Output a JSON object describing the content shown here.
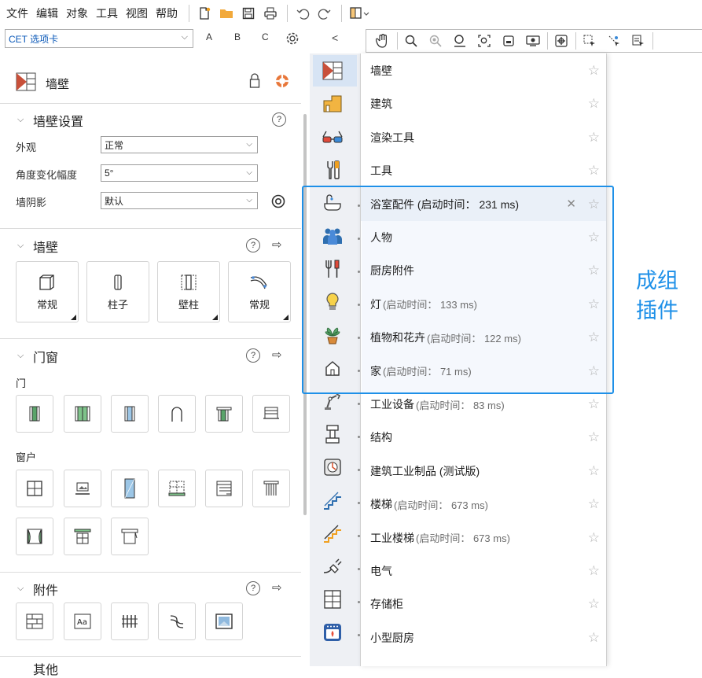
{
  "menubar": {
    "items": [
      "文件",
      "编辑",
      "对象",
      "工具",
      "视图",
      "帮助"
    ]
  },
  "tab_select": {
    "value": "CET 选项卡"
  },
  "abc": [
    "A",
    "B",
    "C"
  ],
  "collapse_arrow": "<",
  "panel": {
    "title": "墙壁",
    "settings": {
      "title": "墙壁设置",
      "fields": [
        {
          "label": "外观",
          "value": "正常"
        },
        {
          "label": "角度变化幅度",
          "value": "5°"
        },
        {
          "label": "墙阴影",
          "value": "默认"
        }
      ]
    },
    "walls": {
      "title": "墙壁",
      "tiles": [
        "常规",
        "柱子",
        "壁柱",
        "常规"
      ]
    },
    "doors_windows": {
      "title": "门窗",
      "doors_label": "门",
      "windows_label": "窗户"
    },
    "accessories": {
      "title": "附件"
    },
    "next_section": "其他"
  },
  "dropdown": {
    "items": [
      {
        "name": "墙壁",
        "startup": ""
      },
      {
        "name": "建筑",
        "startup": ""
      },
      {
        "name": "渲染工具",
        "startup": ""
      },
      {
        "name": "工具",
        "startup": ""
      },
      {
        "name": "浴室配件 (启动时间： 231 ms)",
        "startup": ""
      },
      {
        "name": "人物",
        "startup": ""
      },
      {
        "name": "厨房附件",
        "startup": ""
      },
      {
        "name": "灯",
        "startup": "(启动时间： 133 ms)"
      },
      {
        "name": "植物和花卉",
        "startup": "(启动时间： 122 ms)"
      },
      {
        "name": "家",
        "startup": "(启动时间： 71 ms)"
      },
      {
        "name": "工业设备",
        "startup": "(启动时间： 83 ms)"
      },
      {
        "name": "结构",
        "startup": ""
      },
      {
        "name": "建筑工业制品 (测试版)",
        "startup": ""
      },
      {
        "name": "楼梯",
        "startup": "(启动时间： 673 ms)"
      },
      {
        "name": "工业楼梯",
        "startup": "(启动时间： 673 ms)"
      },
      {
        "name": "电气",
        "startup": ""
      },
      {
        "name": "存储柜",
        "startup": ""
      },
      {
        "name": "小型厨房",
        "startup": ""
      }
    ],
    "star": "☆",
    "close": "✕"
  },
  "annotation": {
    "line1": "成组",
    "line2": "插件",
    "color": "#1e90e8"
  }
}
